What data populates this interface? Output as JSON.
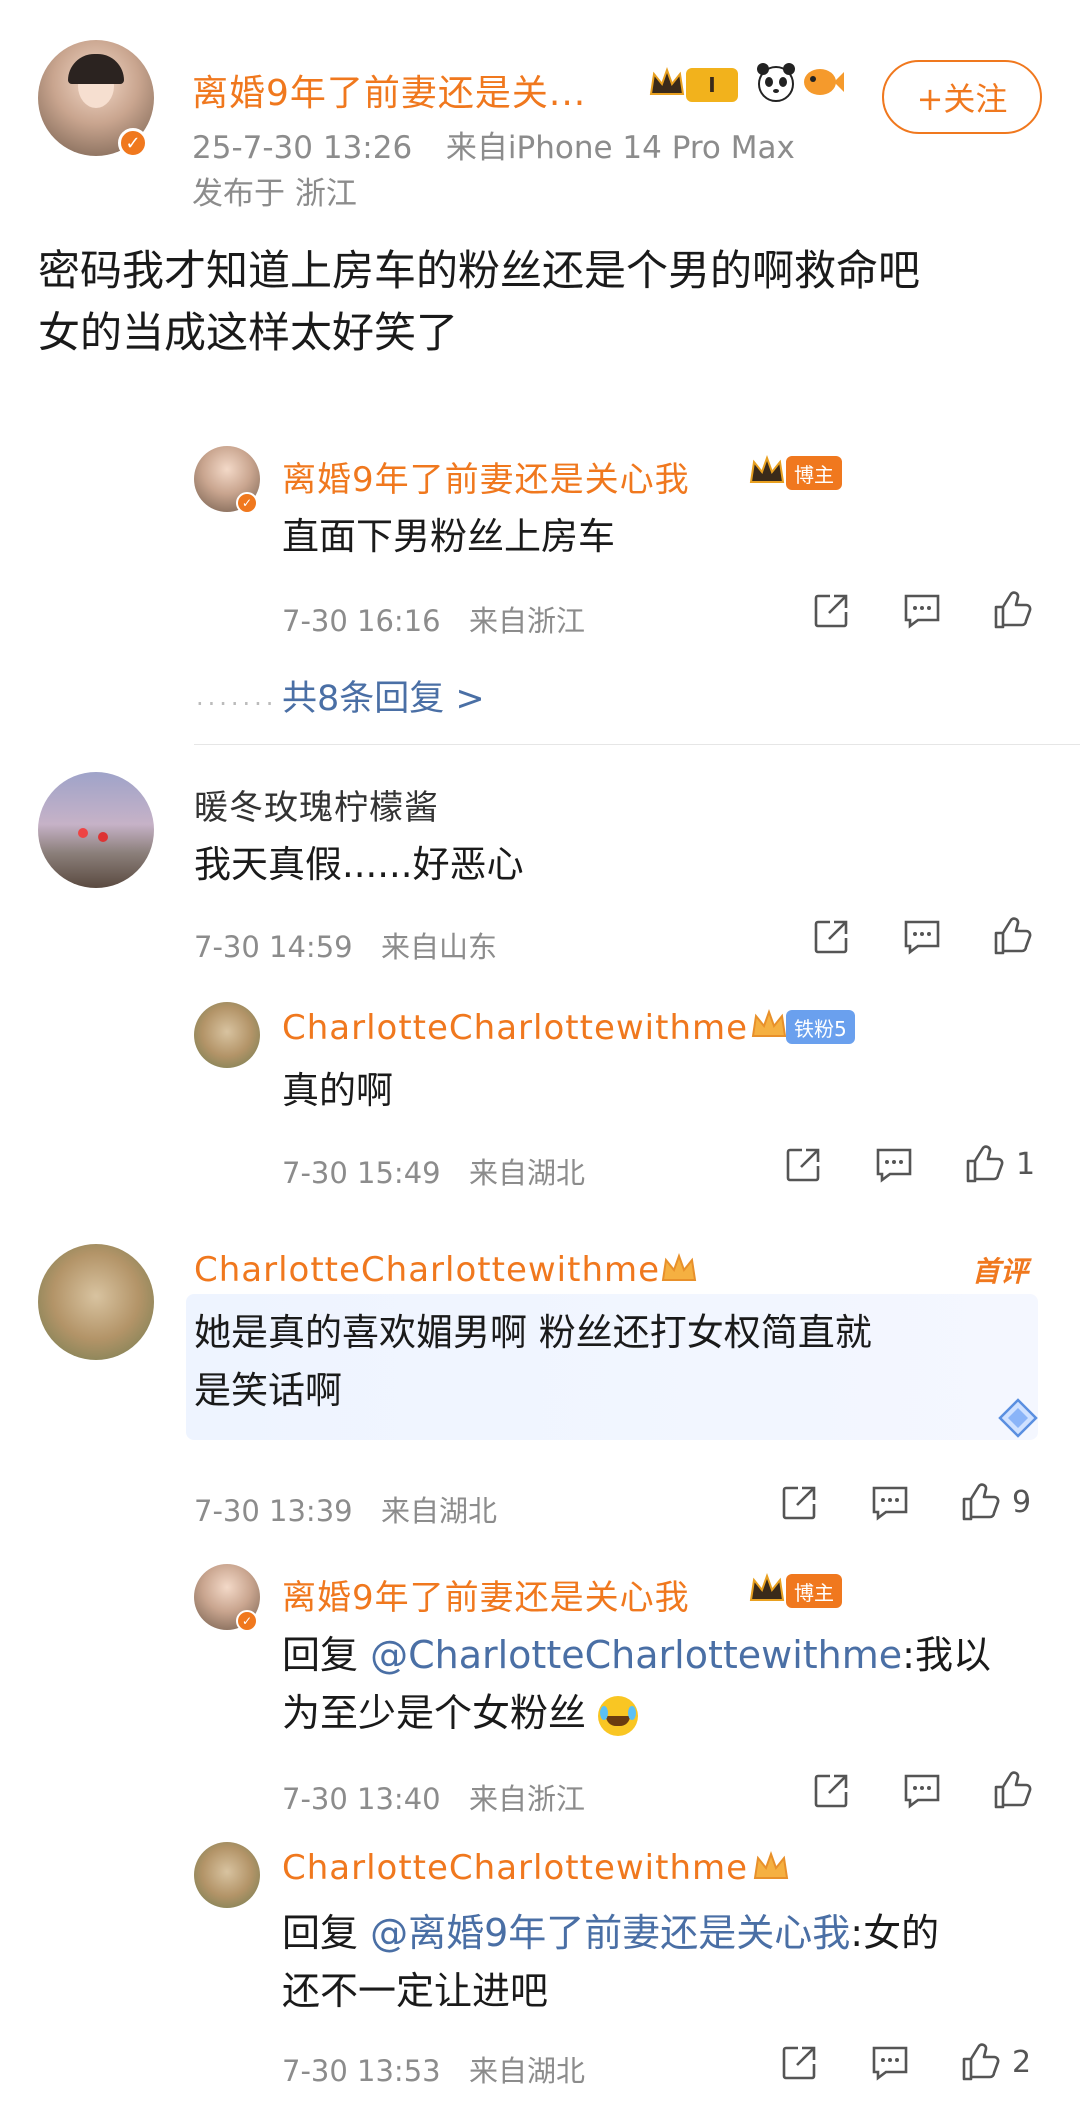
{
  "post": {
    "author": "离婚9年了前妻还是关...",
    "timestamp": "25-7-30 13:26",
    "source": "来自iPhone 14 Pro Max",
    "location": "发布于 浙江",
    "follow_label": "+关注",
    "level_badge": "I",
    "content_line1": "密码我才知道上房车的粉丝还是个男的啊救命吧",
    "content_line2": "女的当成这样太好笑了"
  },
  "comments": [
    {
      "author": "离婚9年了前妻还是关心我",
      "badge": "博主",
      "text": "直面下男粉丝上房车",
      "time": "7-30 16:16",
      "from": "来自浙江",
      "replies_link": "共8条回复 >"
    },
    {
      "author": "暖冬玫瑰柠檬酱",
      "text": "我天真假......好恶心",
      "time": "7-30 14:59",
      "from": "来自山东"
    },
    {
      "author": "CharlotteCharlottewithme",
      "badge": "铁粉5",
      "text": "真的啊",
      "time": "7-30 15:49",
      "from": "来自湖北",
      "likes": "1"
    },
    {
      "author": "CharlotteCharlottewithme",
      "tag": "首评",
      "text_line1": "她是真的喜欢媚男啊 粉丝还打女权简直就",
      "text_line2": "是笑话啊",
      "time": "7-30 13:39",
      "from": "来自湖北",
      "likes": "9"
    },
    {
      "author": "离婚9年了前妻还是关心我",
      "badge": "博主",
      "reply_prefix": "回复 ",
      "mention": "@CharlotteCharlottewithme",
      "text_line1": ":我以",
      "text_line2": "为至少是个女粉丝",
      "time": "7-30 13:40",
      "from": "来自浙江"
    },
    {
      "author": "CharlotteCharlottewithme",
      "reply_prefix": "回复 ",
      "mention": "@离婚9年了前妻还是关心我",
      "text_line1": ":女的",
      "text_line2": "还不一定让进吧",
      "time": "7-30 13:53",
      "from": "来自湖北",
      "likes": "2"
    }
  ],
  "colors": {
    "accent": "#f0781e",
    "mention": "#4a6fa5",
    "meta": "#8c8c8c"
  }
}
